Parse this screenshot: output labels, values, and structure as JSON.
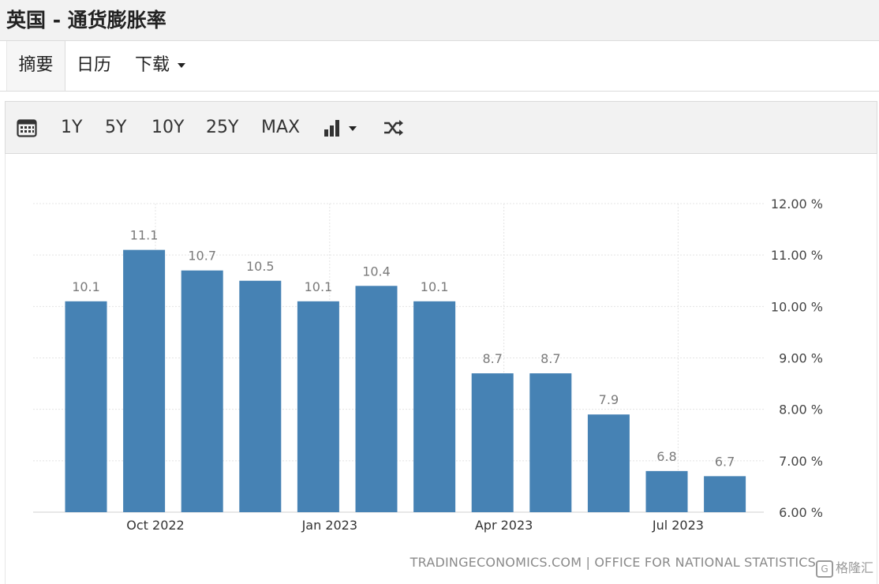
{
  "header": {
    "title": "英国 - 通货膨胀率"
  },
  "tabs": [
    {
      "label": "摘要",
      "active": true
    },
    {
      "label": "日历",
      "active": false
    },
    {
      "label": "下载",
      "active": false
    }
  ],
  "toolbar": {
    "calendar_icon": "calendar-icon",
    "ranges": [
      "1Y",
      "5Y",
      "10Y",
      "25Y",
      "MAX"
    ],
    "chart_type_icon": "bar-chart-icon",
    "shuffle_icon": "shuffle-icon"
  },
  "chart_data": {
    "type": "bar",
    "color": "#4682b4",
    "categories": [
      "Sep 2022",
      "Oct 2022",
      "Nov 2022",
      "Dec 2022",
      "Jan 2023",
      "Feb 2023",
      "Mar 2023",
      "Apr 2023",
      "May 2023",
      "Jun 2023",
      "Jul 2023",
      "Aug 2023"
    ],
    "values": [
      10.1,
      11.1,
      10.7,
      10.5,
      10.1,
      10.4,
      10.1,
      8.7,
      8.7,
      7.9,
      6.8,
      6.7
    ],
    "data_labels": [
      "10.1",
      "11.1",
      "10.7",
      "10.5",
      "10.1",
      "10.4",
      "10.1",
      "8.7",
      "8.7",
      "7.9",
      "6.8",
      "6.7"
    ],
    "x_tick_labels": [
      {
        "label": "Oct 2022",
        "index": 1
      },
      {
        "label": "Jan 2023",
        "index": 4
      },
      {
        "label": "Apr 2023",
        "index": 7
      },
      {
        "label": "Jul 2023",
        "index": 10
      }
    ],
    "y_ticks": [
      6,
      7,
      8,
      9,
      10,
      11,
      12
    ],
    "y_tick_labels": [
      "6.00 %",
      "7.00 %",
      "8.00 %",
      "9.00 %",
      "10.00 %",
      "11.00 %",
      "12.00 %"
    ],
    "ylim": [
      6,
      12
    ],
    "y_axis_side": "right",
    "grid": true,
    "title": "",
    "xlabel": "",
    "ylabel": ""
  },
  "source": "TRADINGECONOMICS.COM | OFFICE FOR NATIONAL STATISTICS",
  "watermark": "格隆汇"
}
